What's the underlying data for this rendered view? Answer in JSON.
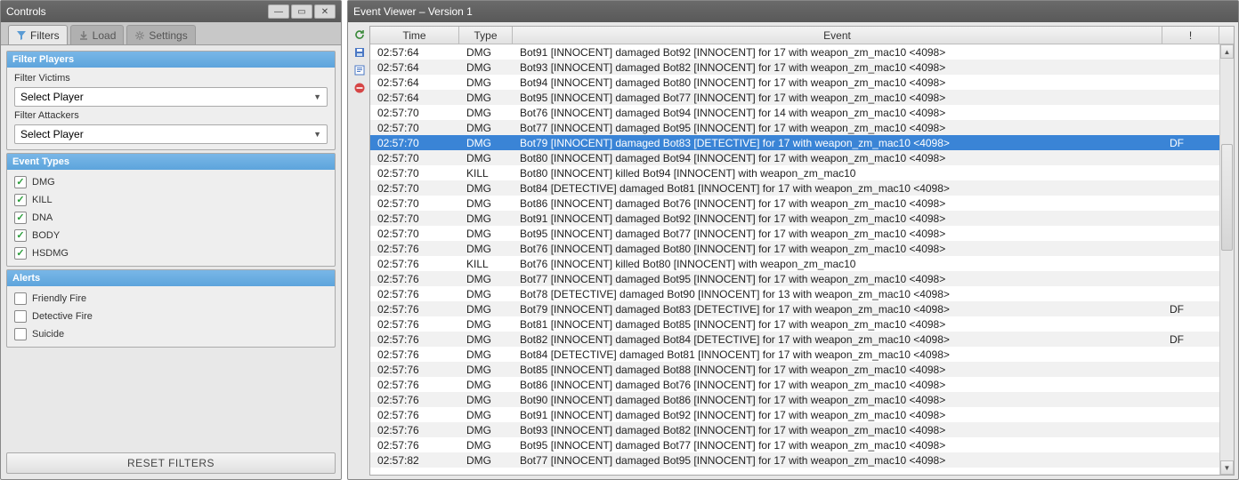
{
  "controls": {
    "title": "Controls",
    "tabs": {
      "filters": "Filters",
      "load": "Load",
      "settings": "Settings"
    },
    "filter_players_header": "Filter Players",
    "filter_victims_label": "Filter Victims",
    "filter_attackers_label": "Filter Attackers",
    "select_player": "Select Player",
    "event_types_header": "Event Types",
    "event_types": [
      "DMG",
      "KILL",
      "DNA",
      "BODY",
      "HSDMG"
    ],
    "alerts_header": "Alerts",
    "alerts": [
      "Friendly Fire",
      "Detective Fire",
      "Suicide"
    ],
    "reset_button": "RESET FILTERS"
  },
  "viewer": {
    "title": "Event Viewer – Version 1",
    "icon_refresh": "refresh",
    "icon_save": "save",
    "icon_delete": "delete",
    "columns": {
      "time": "Time",
      "type": "Type",
      "event": "Event",
      "flag": "!"
    },
    "rows": [
      {
        "time": "02:57:64",
        "type": "DMG",
        "event": "Bot91 [INNOCENT] damaged Bot92 [INNOCENT] for 17 with weapon_zm_mac10 <4098>",
        "flag": "",
        "selected": false
      },
      {
        "time": "02:57:64",
        "type": "DMG",
        "event": "Bot93 [INNOCENT] damaged Bot82 [INNOCENT] for 17 with weapon_zm_mac10 <4098>",
        "flag": "",
        "selected": false
      },
      {
        "time": "02:57:64",
        "type": "DMG",
        "event": "Bot94 [INNOCENT] damaged Bot80 [INNOCENT] for 17 with weapon_zm_mac10 <4098>",
        "flag": "",
        "selected": false
      },
      {
        "time": "02:57:64",
        "type": "DMG",
        "event": "Bot95 [INNOCENT] damaged Bot77 [INNOCENT] for 17 with weapon_zm_mac10 <4098>",
        "flag": "",
        "selected": false
      },
      {
        "time": "02:57:70",
        "type": "DMG",
        "event": "Bot76 [INNOCENT] damaged Bot94 [INNOCENT] for 14 with weapon_zm_mac10 <4098>",
        "flag": "",
        "selected": false
      },
      {
        "time": "02:57:70",
        "type": "DMG",
        "event": "Bot77 [INNOCENT] damaged Bot95 [INNOCENT] for 17 with weapon_zm_mac10 <4098>",
        "flag": "",
        "selected": false
      },
      {
        "time": "02:57:70",
        "type": "DMG",
        "event": "Bot79 [INNOCENT] damaged Bot83 [DETECTIVE] for 17 with weapon_zm_mac10 <4098>",
        "flag": "DF",
        "selected": true
      },
      {
        "time": "02:57:70",
        "type": "DMG",
        "event": "Bot80 [INNOCENT] damaged Bot94 [INNOCENT] for 17 with weapon_zm_mac10 <4098>",
        "flag": "",
        "selected": false
      },
      {
        "time": "02:57:70",
        "type": "KILL",
        "event": "Bot80 [INNOCENT] killed Bot94 [INNOCENT] with weapon_zm_mac10",
        "flag": "",
        "selected": false
      },
      {
        "time": "02:57:70",
        "type": "DMG",
        "event": "Bot84 [DETECTIVE] damaged Bot81 [INNOCENT] for 17 with weapon_zm_mac10 <4098>",
        "flag": "",
        "selected": false
      },
      {
        "time": "02:57:70",
        "type": "DMG",
        "event": "Bot86 [INNOCENT] damaged Bot76 [INNOCENT] for 17 with weapon_zm_mac10 <4098>",
        "flag": "",
        "selected": false
      },
      {
        "time": "02:57:70",
        "type": "DMG",
        "event": "Bot91 [INNOCENT] damaged Bot92 [INNOCENT] for 17 with weapon_zm_mac10 <4098>",
        "flag": "",
        "selected": false
      },
      {
        "time": "02:57:70",
        "type": "DMG",
        "event": "Bot95 [INNOCENT] damaged Bot77 [INNOCENT] for 17 with weapon_zm_mac10 <4098>",
        "flag": "",
        "selected": false
      },
      {
        "time": "02:57:76",
        "type": "DMG",
        "event": "Bot76 [INNOCENT] damaged Bot80 [INNOCENT] for 17 with weapon_zm_mac10 <4098>",
        "flag": "",
        "selected": false
      },
      {
        "time": "02:57:76",
        "type": "KILL",
        "event": "Bot76 [INNOCENT] killed Bot80 [INNOCENT] with weapon_zm_mac10",
        "flag": "",
        "selected": false
      },
      {
        "time": "02:57:76",
        "type": "DMG",
        "event": "Bot77 [INNOCENT] damaged Bot95 [INNOCENT] for 17 with weapon_zm_mac10 <4098>",
        "flag": "",
        "selected": false
      },
      {
        "time": "02:57:76",
        "type": "DMG",
        "event": "Bot78 [DETECTIVE] damaged Bot90 [INNOCENT] for 13 with weapon_zm_mac10 <4098>",
        "flag": "",
        "selected": false
      },
      {
        "time": "02:57:76",
        "type": "DMG",
        "event": "Bot79 [INNOCENT] damaged Bot83 [DETECTIVE] for 17 with weapon_zm_mac10 <4098>",
        "flag": "DF",
        "selected": false
      },
      {
        "time": "02:57:76",
        "type": "DMG",
        "event": "Bot81 [INNOCENT] damaged Bot85 [INNOCENT] for 17 with weapon_zm_mac10 <4098>",
        "flag": "",
        "selected": false
      },
      {
        "time": "02:57:76",
        "type": "DMG",
        "event": "Bot82 [INNOCENT] damaged Bot84 [DETECTIVE] for 17 with weapon_zm_mac10 <4098>",
        "flag": "DF",
        "selected": false
      },
      {
        "time": "02:57:76",
        "type": "DMG",
        "event": "Bot84 [DETECTIVE] damaged Bot81 [INNOCENT] for 17 with weapon_zm_mac10 <4098>",
        "flag": "",
        "selected": false
      },
      {
        "time": "02:57:76",
        "type": "DMG",
        "event": "Bot85 [INNOCENT] damaged Bot88 [INNOCENT] for 17 with weapon_zm_mac10 <4098>",
        "flag": "",
        "selected": false
      },
      {
        "time": "02:57:76",
        "type": "DMG",
        "event": "Bot86 [INNOCENT] damaged Bot76 [INNOCENT] for 17 with weapon_zm_mac10 <4098>",
        "flag": "",
        "selected": false
      },
      {
        "time": "02:57:76",
        "type": "DMG",
        "event": "Bot90 [INNOCENT] damaged Bot86 [INNOCENT] for 17 with weapon_zm_mac10 <4098>",
        "flag": "",
        "selected": false
      },
      {
        "time": "02:57:76",
        "type": "DMG",
        "event": "Bot91 [INNOCENT] damaged Bot92 [INNOCENT] for 17 with weapon_zm_mac10 <4098>",
        "flag": "",
        "selected": false
      },
      {
        "time": "02:57:76",
        "type": "DMG",
        "event": "Bot93 [INNOCENT] damaged Bot82 [INNOCENT] for 17 with weapon_zm_mac10 <4098>",
        "flag": "",
        "selected": false
      },
      {
        "time": "02:57:76",
        "type": "DMG",
        "event": "Bot95 [INNOCENT] damaged Bot77 [INNOCENT] for 17 with weapon_zm_mac10 <4098>",
        "flag": "",
        "selected": false
      },
      {
        "time": "02:57:82",
        "type": "DMG",
        "event": "Bot77 [INNOCENT] damaged Bot95 [INNOCENT] for 17 with weapon_zm_mac10 <4098>",
        "flag": "",
        "selected": false
      }
    ]
  }
}
